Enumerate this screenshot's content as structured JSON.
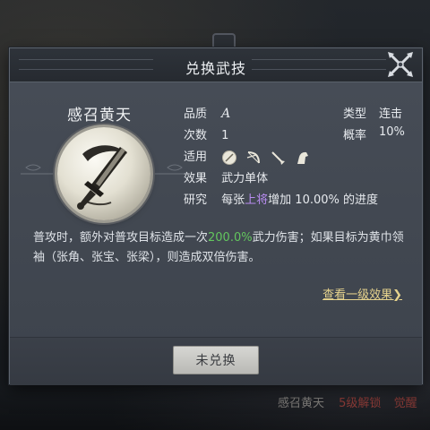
{
  "dialog": {
    "title": "兑换武技",
    "close_icon": "crossed-swords-close-icon"
  },
  "skill": {
    "name": "感召黄天",
    "emblem_icon": "sword-emblem-icon",
    "quality_label": "品质",
    "quality_value": "A",
    "count_label": "次数",
    "count_value": "1",
    "type_label": "类型",
    "type_value": "连击",
    "rate_label": "概率",
    "rate_value": "10%",
    "applies_label": "适用",
    "applies_icons": [
      "shield-icon",
      "bow-icon",
      "spear-icon",
      "horse-icon"
    ],
    "effect_label": "效果",
    "effect_value": "武力单体",
    "research_label": "研究",
    "research_prefix": "每张",
    "research_highlight": "上将",
    "research_suffix": "增加 10.00% 的进度",
    "description_part1": "普攻时，额外对普攻目标造成一次",
    "description_highlight": "200.0%",
    "description_part2": "武力伤害；如果目标为黄巾领袖（张角、张宝、张梁），则造成双倍伤害。",
    "view_level1_link": "查看一级效果❯"
  },
  "footer": {
    "exchange_button": "未兑换"
  },
  "background": {
    "skill_name": "感召黄天",
    "unlock_text": "5级解锁",
    "awaken_text": "觉醒"
  },
  "colors": {
    "green_highlight": "#63c65e",
    "purple_highlight": "#b88cf0",
    "link_gold": "#e6d38d"
  }
}
